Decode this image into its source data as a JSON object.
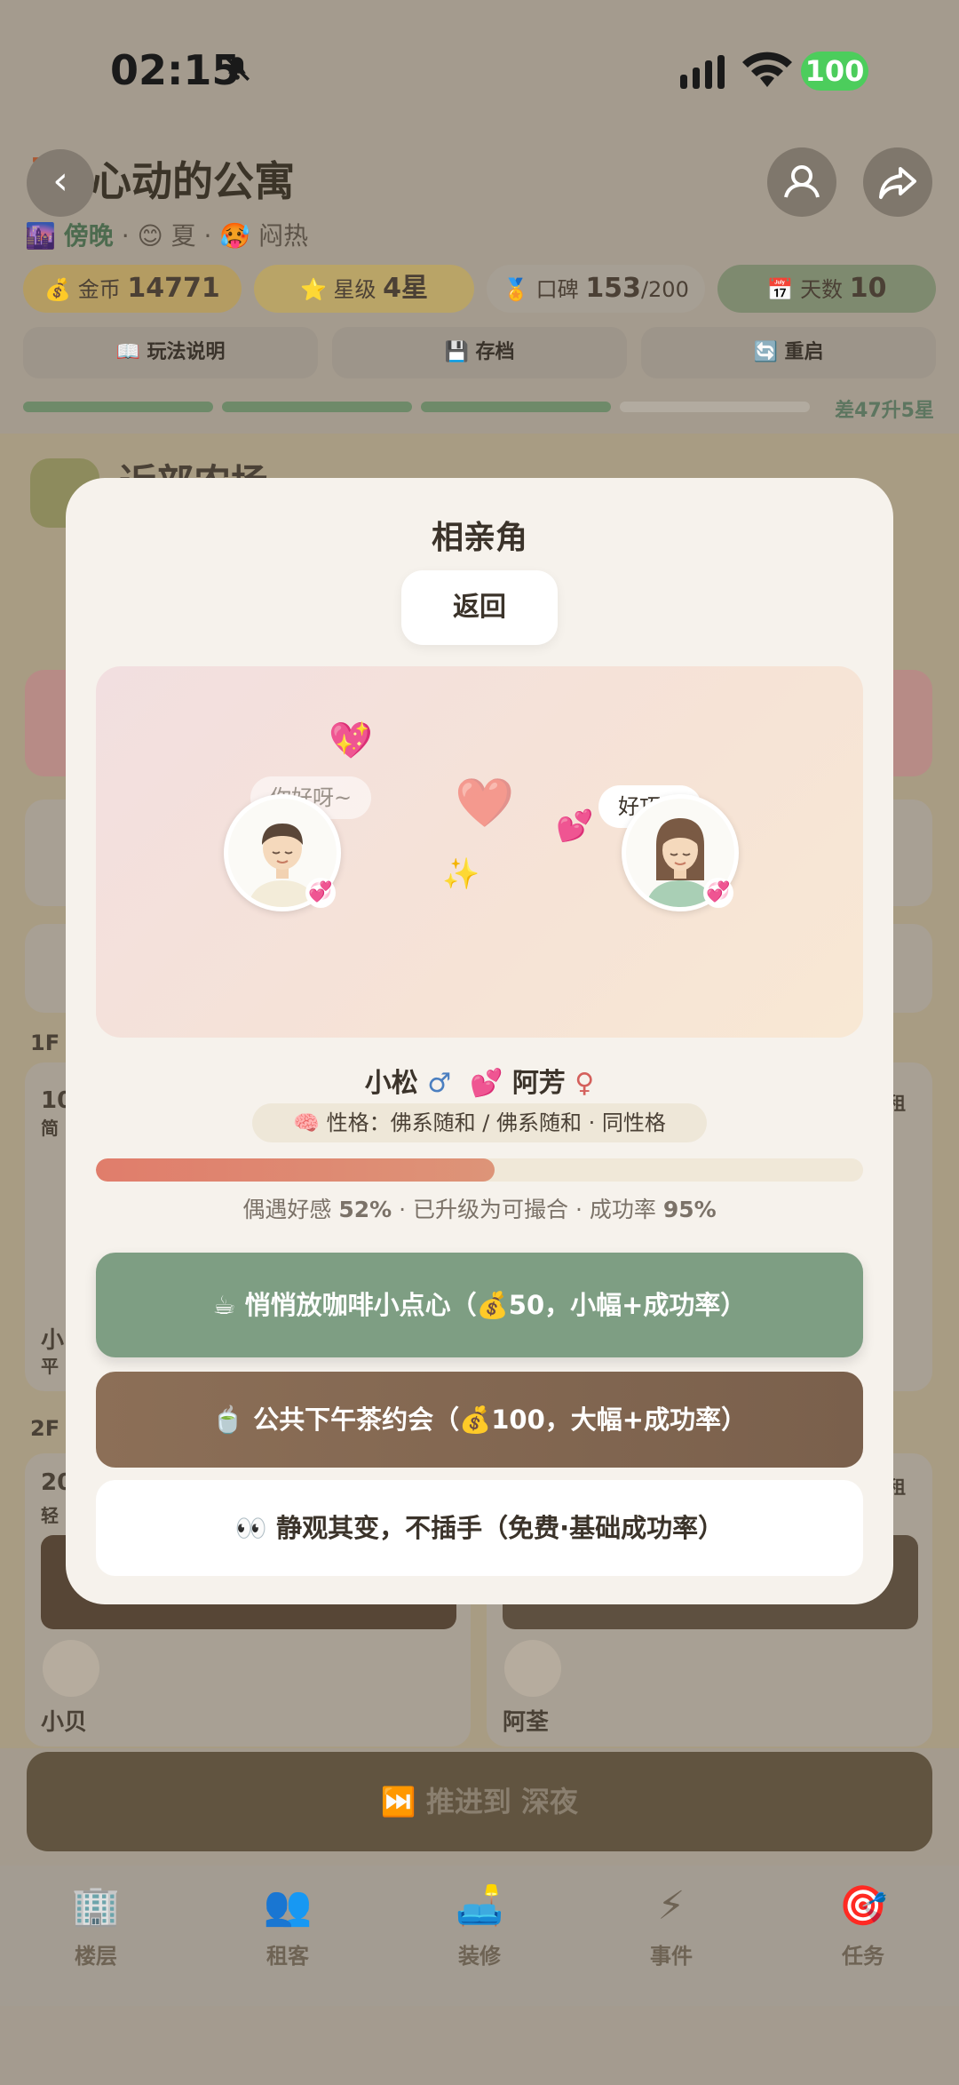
{
  "status": {
    "time": "02:15",
    "battery": "100"
  },
  "header": {
    "title": "心动的公寓",
    "subtitle": {
      "period": "傍晚",
      "season": "夏",
      "weather": "闷热",
      "sep": "·"
    },
    "stats": [
      {
        "label": "金币",
        "value": "14771"
      },
      {
        "label": "星级",
        "value": "4星"
      },
      {
        "label": "口碑",
        "value": "153",
        "suffix": "/200"
      },
      {
        "label": "天数",
        "value": "10"
      }
    ],
    "tools": [
      "玩法说明",
      "存档",
      "重启"
    ],
    "level_progress": {
      "segments_filled": 3,
      "segments_total": 4,
      "label": "差47升5星"
    }
  },
  "background": {
    "section_title": "近部农场",
    "floor1_label": "1F",
    "floor2_label": "2F",
    "room1_num": "10",
    "room1_sub": "简",
    "room1_tenant": "小",
    "room1_tenant_sub": "平",
    "room2_num": "20",
    "room2_sub": "轻",
    "tenant_a": "小贝",
    "tenant_b": "阿荃",
    "tag": "租"
  },
  "advance_button": "⏭️ 推进到 深夜",
  "tabs": [
    {
      "icon": "🏢",
      "label": "楼层"
    },
    {
      "icon": "👥",
      "label": "租客"
    },
    {
      "icon": "🛋️",
      "label": "装修"
    },
    {
      "icon": "⚡",
      "label": "事件"
    },
    {
      "icon": "🎯",
      "label": "任务"
    }
  ],
  "modal": {
    "title": "相亲角",
    "back_label": "返回",
    "scene": {
      "left_bubble": "你好呀~",
      "right_bubble": "好巧！"
    },
    "left_name": "小松",
    "right_name": "阿芳",
    "male_symbol": "♂",
    "female_symbol": "♀",
    "trait": "性格：佛系随和 / 佛系随和 · 同性格",
    "affection_percent": 52,
    "affect_prefix": "偶遇好感",
    "affect_value": "52%",
    "affect_mid": "· 已升级为可撮合 · 成功率",
    "success_value": "95%",
    "options": [
      "☕ 悄悄放咖啡小点心（💰50，小幅+成功率）",
      "🍵 公共下午茶约会（💰100，大幅+成功率）",
      "👀 静观其变，不插手（免费·基础成功率）"
    ]
  }
}
